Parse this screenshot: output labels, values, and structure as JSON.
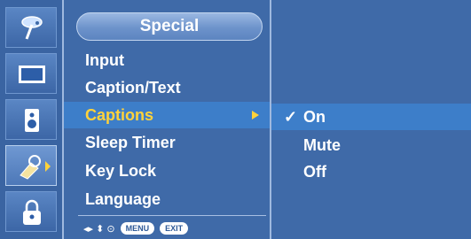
{
  "icons": [
    {
      "name": "picture-icon"
    },
    {
      "name": "screen-icon"
    },
    {
      "name": "audio-icon"
    },
    {
      "name": "special-icon"
    },
    {
      "name": "lock-icon"
    }
  ],
  "menu": {
    "title": "Special",
    "items": [
      {
        "label": "Input"
      },
      {
        "label": "Caption/Text"
      },
      {
        "label": "Captions"
      },
      {
        "label": "Sleep Timer"
      },
      {
        "label": "Key Lock"
      },
      {
        "label": "Language"
      }
    ],
    "active_index": 2
  },
  "submenu": {
    "items": [
      {
        "label": "On",
        "check": "✓"
      },
      {
        "label": "Mute",
        "check": ""
      },
      {
        "label": "Off",
        "check": ""
      }
    ],
    "active_index": 0
  },
  "help": {
    "nav_symbols": "◂▸ ⬍ ⊙",
    "menu_label": "MENU",
    "exit_label": "EXIT"
  },
  "colors": {
    "panel": "#3f6aa8",
    "highlight": "#3d7ec9",
    "active_text": "#ffd23a"
  }
}
